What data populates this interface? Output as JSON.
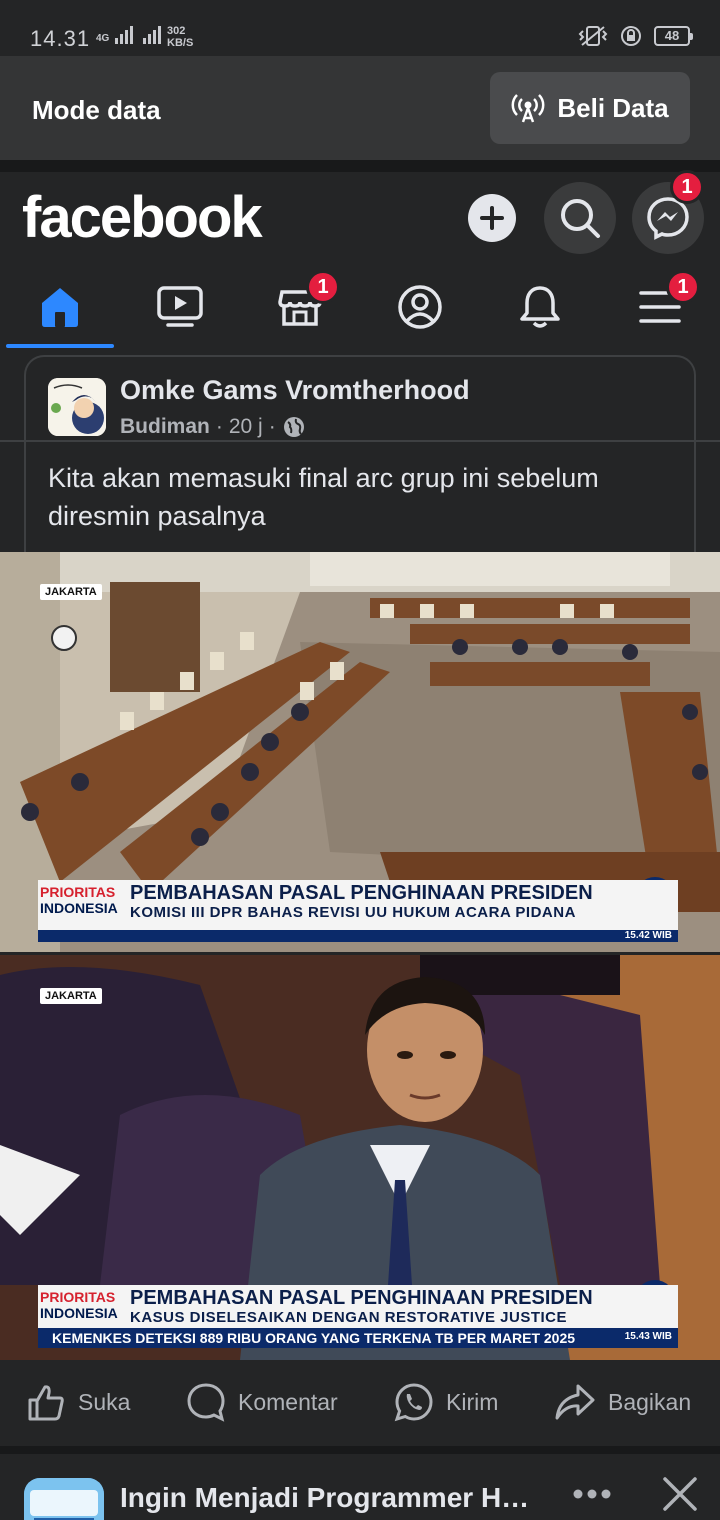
{
  "status_bar": {
    "time": "14.31",
    "network": "4G",
    "speed_value": "302",
    "speed_unit": "KB/S",
    "battery": "48"
  },
  "data_banner": {
    "label": "Mode data",
    "buy_button": "Beli Data"
  },
  "header": {
    "logo": "facebook",
    "messenger_badge": "1"
  },
  "tabs": [
    {
      "name": "home",
      "active": true
    },
    {
      "name": "video"
    },
    {
      "name": "marketplace",
      "badge": "1"
    },
    {
      "name": "profile"
    },
    {
      "name": "notifications"
    },
    {
      "name": "menu",
      "badge": "1"
    }
  ],
  "post": {
    "group_name": "Omke Gams Vromtherhood",
    "author": "Budiman",
    "time": "20 j",
    "separator": "·",
    "text": "Kita akan memasuki final arc grup ini sebelum diresmin pasalnya",
    "images": [
      {
        "location": "JAKARTA",
        "brand_line1": "PRIORITAS",
        "brand_line2": "INDONESIA",
        "headline": "PEMBAHASAN PASAL PENGHINAAN PRESIDEN",
        "subline": "KOMISI III DPR BAHAS REVISI UU HUKUM ACARA PIDANA",
        "timestamp": "15.42 WIB"
      },
      {
        "location": "JAKARTA",
        "brand_line1": "PRIORITAS",
        "brand_line2": "INDONESIA",
        "headline": "PEMBAHASAN PASAL PENGHINAAN PRESIDEN",
        "subline": "KASUS DISELESAIKAN DENGAN RESTORATIVE JUSTICE",
        "ticker": "KEMENKES DETEKSI 889 RIBU ORANG YANG TERKENA TB PER MARET 2025",
        "timestamp": "15.43 WIB"
      }
    ]
  },
  "actions": {
    "like": "Suka",
    "comment": "Komentar",
    "send": "Kirim",
    "share": "Bagikan"
  },
  "next_post": {
    "title": "Ingin Menjadi Programmer Ha..."
  },
  "colors": {
    "background": "#242526",
    "accent": "#2d88ff",
    "badge": "#e41e3f",
    "text": "#e4e6eb",
    "secondary_text": "#b0b3b8"
  }
}
